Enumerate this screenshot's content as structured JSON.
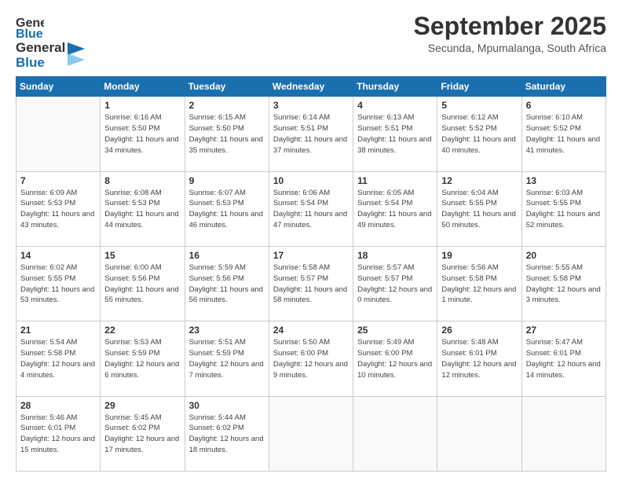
{
  "header": {
    "logo_line1": "General",
    "logo_line2": "Blue",
    "month": "September 2025",
    "location": "Secunda, Mpumalanga, South Africa"
  },
  "days_of_week": [
    "Sunday",
    "Monday",
    "Tuesday",
    "Wednesday",
    "Thursday",
    "Friday",
    "Saturday"
  ],
  "weeks": [
    [
      {
        "day": "",
        "sunrise": "",
        "sunset": "",
        "daylight": ""
      },
      {
        "day": "1",
        "sunrise": "6:16 AM",
        "sunset": "5:50 PM",
        "daylight": "11 hours and 34 minutes."
      },
      {
        "day": "2",
        "sunrise": "6:15 AM",
        "sunset": "5:50 PM",
        "daylight": "11 hours and 35 minutes."
      },
      {
        "day": "3",
        "sunrise": "6:14 AM",
        "sunset": "5:51 PM",
        "daylight": "11 hours and 37 minutes."
      },
      {
        "day": "4",
        "sunrise": "6:13 AM",
        "sunset": "5:51 PM",
        "daylight": "11 hours and 38 minutes."
      },
      {
        "day": "5",
        "sunrise": "6:12 AM",
        "sunset": "5:52 PM",
        "daylight": "11 hours and 40 minutes."
      },
      {
        "day": "6",
        "sunrise": "6:10 AM",
        "sunset": "5:52 PM",
        "daylight": "11 hours and 41 minutes."
      }
    ],
    [
      {
        "day": "7",
        "sunrise": "6:09 AM",
        "sunset": "5:53 PM",
        "daylight": "11 hours and 43 minutes."
      },
      {
        "day": "8",
        "sunrise": "6:08 AM",
        "sunset": "5:53 PM",
        "daylight": "11 hours and 44 minutes."
      },
      {
        "day": "9",
        "sunrise": "6:07 AM",
        "sunset": "5:53 PM",
        "daylight": "11 hours and 46 minutes."
      },
      {
        "day": "10",
        "sunrise": "6:06 AM",
        "sunset": "5:54 PM",
        "daylight": "11 hours and 47 minutes."
      },
      {
        "day": "11",
        "sunrise": "6:05 AM",
        "sunset": "5:54 PM",
        "daylight": "11 hours and 49 minutes."
      },
      {
        "day": "12",
        "sunrise": "6:04 AM",
        "sunset": "5:55 PM",
        "daylight": "11 hours and 50 minutes."
      },
      {
        "day": "13",
        "sunrise": "6:03 AM",
        "sunset": "5:55 PM",
        "daylight": "11 hours and 52 minutes."
      }
    ],
    [
      {
        "day": "14",
        "sunrise": "6:02 AM",
        "sunset": "5:55 PM",
        "daylight": "11 hours and 53 minutes."
      },
      {
        "day": "15",
        "sunrise": "6:00 AM",
        "sunset": "5:56 PM",
        "daylight": "11 hours and 55 minutes."
      },
      {
        "day": "16",
        "sunrise": "5:59 AM",
        "sunset": "5:56 PM",
        "daylight": "11 hours and 56 minutes."
      },
      {
        "day": "17",
        "sunrise": "5:58 AM",
        "sunset": "5:57 PM",
        "daylight": "11 hours and 58 minutes."
      },
      {
        "day": "18",
        "sunrise": "5:57 AM",
        "sunset": "5:57 PM",
        "daylight": "12 hours and 0 minutes."
      },
      {
        "day": "19",
        "sunrise": "5:56 AM",
        "sunset": "5:58 PM",
        "daylight": "12 hours and 1 minute."
      },
      {
        "day": "20",
        "sunrise": "5:55 AM",
        "sunset": "5:58 PM",
        "daylight": "12 hours and 3 minutes."
      }
    ],
    [
      {
        "day": "21",
        "sunrise": "5:54 AM",
        "sunset": "5:58 PM",
        "daylight": "12 hours and 4 minutes."
      },
      {
        "day": "22",
        "sunrise": "5:53 AM",
        "sunset": "5:59 PM",
        "daylight": "12 hours and 6 minutes."
      },
      {
        "day": "23",
        "sunrise": "5:51 AM",
        "sunset": "5:59 PM",
        "daylight": "12 hours and 7 minutes."
      },
      {
        "day": "24",
        "sunrise": "5:50 AM",
        "sunset": "6:00 PM",
        "daylight": "12 hours and 9 minutes."
      },
      {
        "day": "25",
        "sunrise": "5:49 AM",
        "sunset": "6:00 PM",
        "daylight": "12 hours and 10 minutes."
      },
      {
        "day": "26",
        "sunrise": "5:48 AM",
        "sunset": "6:01 PM",
        "daylight": "12 hours and 12 minutes."
      },
      {
        "day": "27",
        "sunrise": "5:47 AM",
        "sunset": "6:01 PM",
        "daylight": "12 hours and 14 minutes."
      }
    ],
    [
      {
        "day": "28",
        "sunrise": "5:46 AM",
        "sunset": "6:01 PM",
        "daylight": "12 hours and 15 minutes."
      },
      {
        "day": "29",
        "sunrise": "5:45 AM",
        "sunset": "6:02 PM",
        "daylight": "12 hours and 17 minutes."
      },
      {
        "day": "30",
        "sunrise": "5:44 AM",
        "sunset": "6:02 PM",
        "daylight": "12 hours and 18 minutes."
      },
      {
        "day": "",
        "sunrise": "",
        "sunset": "",
        "daylight": ""
      },
      {
        "day": "",
        "sunrise": "",
        "sunset": "",
        "daylight": ""
      },
      {
        "day": "",
        "sunrise": "",
        "sunset": "",
        "daylight": ""
      },
      {
        "day": "",
        "sunrise": "",
        "sunset": "",
        "daylight": ""
      }
    ]
  ]
}
